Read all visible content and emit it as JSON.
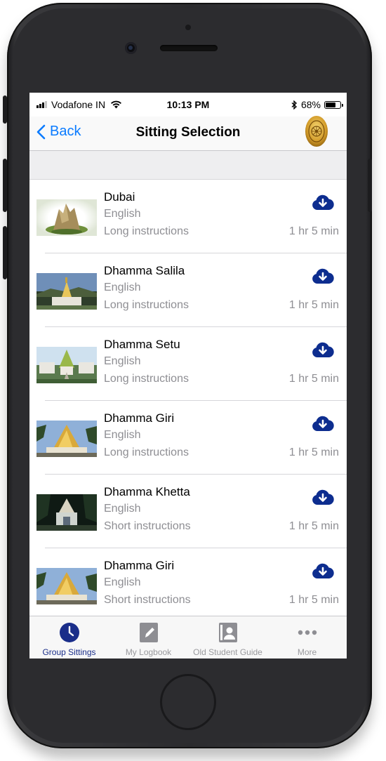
{
  "status_bar": {
    "carrier": "Vodafone IN",
    "time": "10:13 PM",
    "battery": "68%",
    "battery_level": 0.68
  },
  "nav": {
    "back_label": "Back",
    "title": "Sitting Selection"
  },
  "sittings": [
    {
      "name": "Dubai",
      "language": "English",
      "instructions": "Long instructions",
      "duration": "1 hr 5 min",
      "thumb": "rock-stupa"
    },
    {
      "name": "Dhamma Salila",
      "language": "English",
      "instructions": "Long instructions",
      "duration": "1 hr 5 min",
      "thumb": "hill-pagoda"
    },
    {
      "name": "Dhamma Setu",
      "language": "English",
      "instructions": "Long instructions",
      "duration": "1 hr 5 min",
      "thumb": "garden-pagoda"
    },
    {
      "name": "Dhamma Giri",
      "language": "English",
      "instructions": "Long instructions",
      "duration": "1 hr 5 min",
      "thumb": "golden-pagoda"
    },
    {
      "name": "Dhamma Khetta",
      "language": "English",
      "instructions": "Short instructions",
      "duration": "1 hr 5 min",
      "thumb": "night-pagoda"
    },
    {
      "name": "Dhamma Giri",
      "language": "English",
      "instructions": "Short instructions",
      "duration": "1 hr 5 min",
      "thumb": "golden-pagoda"
    }
  ],
  "tabs": [
    {
      "label": "Group Sittings",
      "icon": "clock-icon",
      "active": true
    },
    {
      "label": "My Logbook",
      "icon": "notepad-icon",
      "active": false
    },
    {
      "label": "Old Student Guide",
      "icon": "contact-book-icon",
      "active": false
    },
    {
      "label": "More",
      "icon": "more-dots-icon",
      "active": false
    }
  ],
  "colors": {
    "accent": "#0a7bff",
    "download": "#0d2d8f",
    "tab_active": "#1a2e8a"
  }
}
